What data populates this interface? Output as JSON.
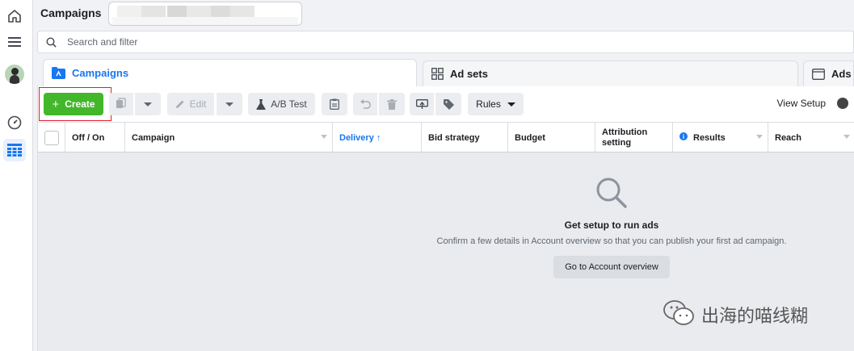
{
  "header": {
    "title": "Campaigns",
    "account_selector_placeholder": ""
  },
  "search": {
    "placeholder": "Search and filter"
  },
  "tabs": [
    {
      "label": "Campaigns",
      "active": true
    },
    {
      "label": "Ad sets",
      "active": false
    },
    {
      "label": "Ads",
      "active": false
    }
  ],
  "toolbar": {
    "create_label": "Create",
    "edit_label": "Edit",
    "ab_test_label": "A/B Test",
    "rules_label": "Rules",
    "view_setup_label": "View Setup"
  },
  "table": {
    "columns": [
      {
        "label": "Off / On"
      },
      {
        "label": "Campaign"
      },
      {
        "label": "Delivery ↑"
      },
      {
        "label": "Bid strategy"
      },
      {
        "label": "Budget"
      },
      {
        "label": "Attribution setting"
      },
      {
        "label": "Results"
      },
      {
        "label": "Reach"
      }
    ]
  },
  "empty_state": {
    "title": "Get setup to run ads",
    "subtitle": "Confirm a few details in Account overview so that you can publish your first ad campaign.",
    "button_label": "Go to Account overview"
  },
  "watermark": {
    "text": "出海的喵线糊"
  },
  "colors": {
    "accent": "#1877f2",
    "create": "#42b72a",
    "highlight": "#d9232e"
  }
}
